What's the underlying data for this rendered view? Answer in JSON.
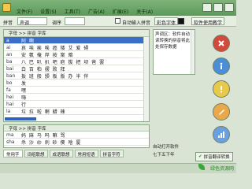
{
  "menu": [
    "文件(F)",
    "设置(S)",
    "工具(T)",
    "广告(A)",
    "扩展(E)",
    "关于(A)"
  ],
  "toolbar": {
    "mode_label": "拼音",
    "mode_value": "声调",
    "sort_label": "调序",
    "checkbox_label": "自动输入拼音",
    "font_button": "彩色字体",
    "help_button": "软件使用教学"
  },
  "main": {
    "header": "字母 >> 拼音 字库",
    "rows": [
      {
        "py": "a",
        "hz": "阿 啊"
      },
      {
        "py": "ai",
        "hz": "哀 埃 挨 唉 癌 矮 艾 爱 碍"
      },
      {
        "py": "an",
        "hz": "安 氨 俺 岸 按 案 暗"
      },
      {
        "py": "ba",
        "hz": "八 巴 叭 扒 吧 疤 拔 把 坝 爸 罢"
      },
      {
        "py": "bai",
        "hz": "白 百 柏 摆 败 拜"
      },
      {
        "py": "ban",
        "hz": "扳 班 般 颁 板 版 办 半 伴"
      },
      {
        "py": "bo",
        "hz": "发"
      },
      {
        "py": "fa",
        "hz": "嘿"
      },
      {
        "py": "hei",
        "hz": "嗨"
      },
      {
        "py": "hai",
        "hz": "行"
      },
      {
        "py": "la",
        "hz": "垃 拉 啦 喇 蜡 辣"
      },
      {
        "py": "pa",
        "hz": "趴 扒 怕 琶 帕 啪"
      },
      {
        "py": "ba",
        "hz": "吧"
      },
      {
        "py": "ta",
        "hz": "他 它 她 塔 踏 塌"
      },
      {
        "py": "ha",
        "hz": "哈"
      }
    ]
  },
  "pane2": {
    "header": "字母 >> 拼音 字库",
    "rows": [
      {
        "py": "ma",
        "hz": "妈 麻 马 吗 嘛 骂"
      },
      {
        "py": "sha",
        "hz": "杀 沙 纱 刹 砂 傻 啥 厦"
      }
    ]
  },
  "tabs": [
    "常用字",
    "词组联想",
    "成语联想",
    "常用短语",
    "拼音字符"
  ],
  "notes": "声调区：软件自动读转换的拼音将此处保存数据",
  "options": {
    "autotext": "自动打开软件",
    "tone": "七下五下年"
  },
  "action_button": "拼音翻译转换",
  "watermark": "绿色资源网"
}
